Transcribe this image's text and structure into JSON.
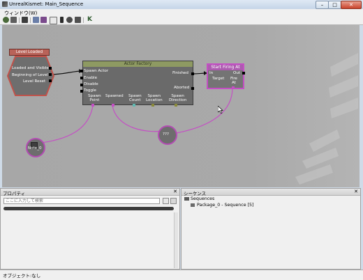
{
  "window": {
    "title": "UnrealKismet: Main_Sequence",
    "min": "–",
    "max": "□",
    "close": "✕"
  },
  "menu": [
    "ウィンドウ(W)"
  ],
  "toolbar_icons": [
    "home-icon",
    "open-icon",
    "save-icon",
    "search-icon",
    "tree-icon",
    "filter-icon",
    "line-icon",
    "pointer-icon",
    "zoom-icon",
    "link-icon",
    "kismet-k-icon"
  ],
  "graph": {
    "level_loaded": {
      "title": "Level Loaded",
      "outputs": [
        "Loaded and Visible",
        "Beginning of Level",
        "Level Reset"
      ]
    },
    "actor_factory": {
      "title": "Actor Factory",
      "inputs": [
        "Spawn Actor",
        "Enable",
        "Disable",
        "Toggle"
      ],
      "outputs": [
        "Finished",
        "Aborted"
      ],
      "vars": [
        "Spawn\nPoint",
        "Spawned",
        "Spawn\nCount",
        "Spawn\nLocation",
        "Spawn\nDirection"
      ]
    },
    "start_firing": {
      "title": "Start Firing At",
      "in": "In",
      "out": "Out",
      "vars": [
        "Target",
        "Fire\nAt"
      ]
    },
    "var_note": "Note_0",
    "var_unknown": "???"
  },
  "properties": {
    "title": "プロパティ",
    "close": "✕",
    "search_placeholder": "ここに入力して検索"
  },
  "sequences": {
    "title": "シーケンス",
    "close": "✕",
    "root": "Sequences",
    "child": "Package_0 - Sequence [5]"
  },
  "status": "オブジェクト:なし",
  "colors": {
    "graph_bg": "#a7a7a7",
    "link_pink": "#c44fc4",
    "node_header": "#8e9a62",
    "event_border": "#c0524a"
  }
}
